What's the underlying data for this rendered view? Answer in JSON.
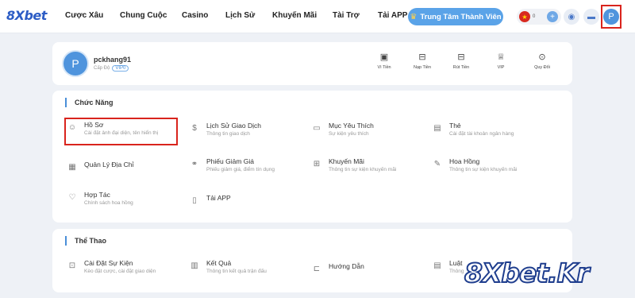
{
  "header": {
    "logo": "8Xbet",
    "nav": [
      "Cược Xâu",
      "Chung Cuộc",
      "Casino",
      "Lịch Sử",
      "Khuyến Mãi",
      "Tài Trợ",
      "Tải APP"
    ],
    "member_button": "Trung Tâm Thành Viên",
    "wallet_amount": "0",
    "avatar_letter": "P"
  },
  "profile": {
    "avatar_letter": "P",
    "username": "pckhang91",
    "level_label": "Cấp Độ",
    "vip_badge": "VIP0",
    "quick_actions": [
      {
        "label": "Vì Tiền",
        "icon": "wallet-icon"
      },
      {
        "label": "Nạp Tiền",
        "icon": "deposit-icon"
      },
      {
        "label": "Rút Tiền",
        "icon": "withdraw-icon"
      },
      {
        "label": "VIP",
        "icon": "crown-icon"
      },
      {
        "label": "Quy Đổi",
        "icon": "exchange-icon"
      }
    ]
  },
  "functions": {
    "title": "Chức Năng",
    "items": [
      {
        "title": "Hồ Sơ",
        "subtitle": "Cài đặt ảnh đại diện, tên hiển thị",
        "icon": "profile-icon"
      },
      {
        "title": "Lịch Sử Giao Dịch",
        "subtitle": "Thông tin giao dịch",
        "icon": "transaction-icon"
      },
      {
        "title": "Mục Yêu Thích",
        "subtitle": "Sự kiện yêu thích",
        "icon": "bookmark-icon"
      },
      {
        "title": "Thẻ",
        "subtitle": "Cài đặt tài khoản ngân hàng",
        "icon": "card-icon"
      },
      {
        "title": "Quản Lý Địa Chỉ",
        "subtitle": "",
        "icon": "address-icon"
      },
      {
        "title": "Phiếu Giảm Giá",
        "subtitle": "Phiếu giảm giá, điểm tín dụng",
        "icon": "coupon-icon"
      },
      {
        "title": "Khuyến Mãi",
        "subtitle": "Thông tin sự kiện khuyến mãi",
        "icon": "gift-icon"
      },
      {
        "title": "Hoa Hồng",
        "subtitle": "Thông tin sự kiện khuyến mãi",
        "icon": "commission-icon"
      },
      {
        "title": "Hợp Tác",
        "subtitle": "Chính sách hoa hồng",
        "icon": "handshake-icon"
      },
      {
        "title": "Tải APP",
        "subtitle": "",
        "icon": "download-app-icon"
      }
    ]
  },
  "sports": {
    "title": "Thể Thao",
    "items": [
      {
        "title": "Cài Đặt Sự Kiện",
        "subtitle": "Kèo đặt cược, cài đặt giao diện",
        "icon": "event-settings-icon"
      },
      {
        "title": "Kết Quả",
        "subtitle": "Thông tin kết quả trận đấu",
        "icon": "results-icon"
      },
      {
        "title": "Hướng Dẫn",
        "subtitle": "",
        "icon": "guide-icon"
      },
      {
        "title": "Luật",
        "subtitle": "Thông",
        "icon": "rules-icon"
      }
    ]
  },
  "watermark": "8Xbet.Kr",
  "colors": {
    "brand": "#2c5cc5",
    "accent": "#5aa3e8",
    "highlight": "#d9241d",
    "background": "#eef1f6"
  }
}
